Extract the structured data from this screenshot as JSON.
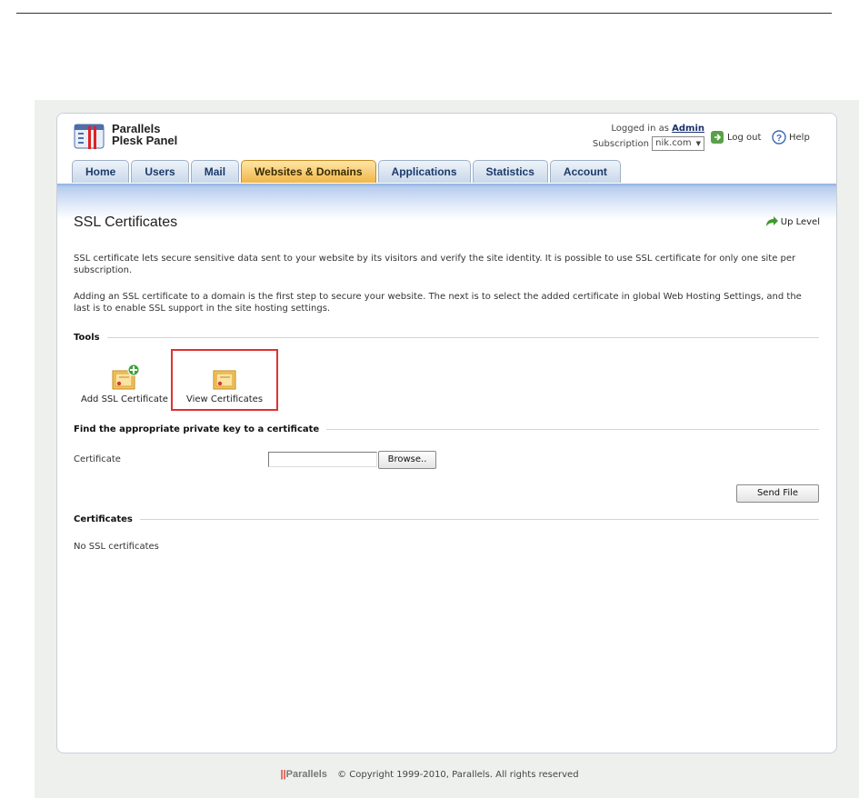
{
  "brand": {
    "line1": "Parallels",
    "line2": "Plesk Panel"
  },
  "user": {
    "logged_in_as": "Logged in as",
    "username": "Admin",
    "subscription_label": "Subscription",
    "subscription_value": "nik.com"
  },
  "header_links": {
    "logout": "Log out",
    "help": "Help"
  },
  "tabs": [
    {
      "label": "Home"
    },
    {
      "label": "Users"
    },
    {
      "label": "Mail"
    },
    {
      "label": "Websites & Domains",
      "active": true
    },
    {
      "label": "Applications"
    },
    {
      "label": "Statistics"
    },
    {
      "label": "Account"
    }
  ],
  "page": {
    "title": "SSL Certificates",
    "up_level": "Up Level",
    "desc1": "SSL certificate lets secure sensitive data sent to your website by its visitors and verify the site identity. It is possible to use SSL certificate for only one site per subscription.",
    "desc2": "Adding an SSL certificate to a domain is the first step to secure your website. The next is to select the added certificate in global Web Hosting Settings, and the last is to enable SSL support in the site hosting settings."
  },
  "tools": {
    "heading": "Tools",
    "add_ssl": "Add SSL Certificate",
    "view_certs": "View Certificates"
  },
  "find_key": {
    "heading": "Find the appropriate private key to a certificate",
    "field_label": "Certificate",
    "field_value": "",
    "browse": "Browse..",
    "send": "Send File"
  },
  "certificates": {
    "heading": "Certificates",
    "empty": "No SSL certificates"
  },
  "footer": {
    "logo": "Parallels",
    "copyright": "© Copyright 1999-2010, Parallels. All rights reserved"
  },
  "colors": {
    "active_tab": "#f0b649",
    "tab": "#c9d8ea",
    "highlight": "#e03030",
    "accent_blue": "#8fb2e0"
  }
}
